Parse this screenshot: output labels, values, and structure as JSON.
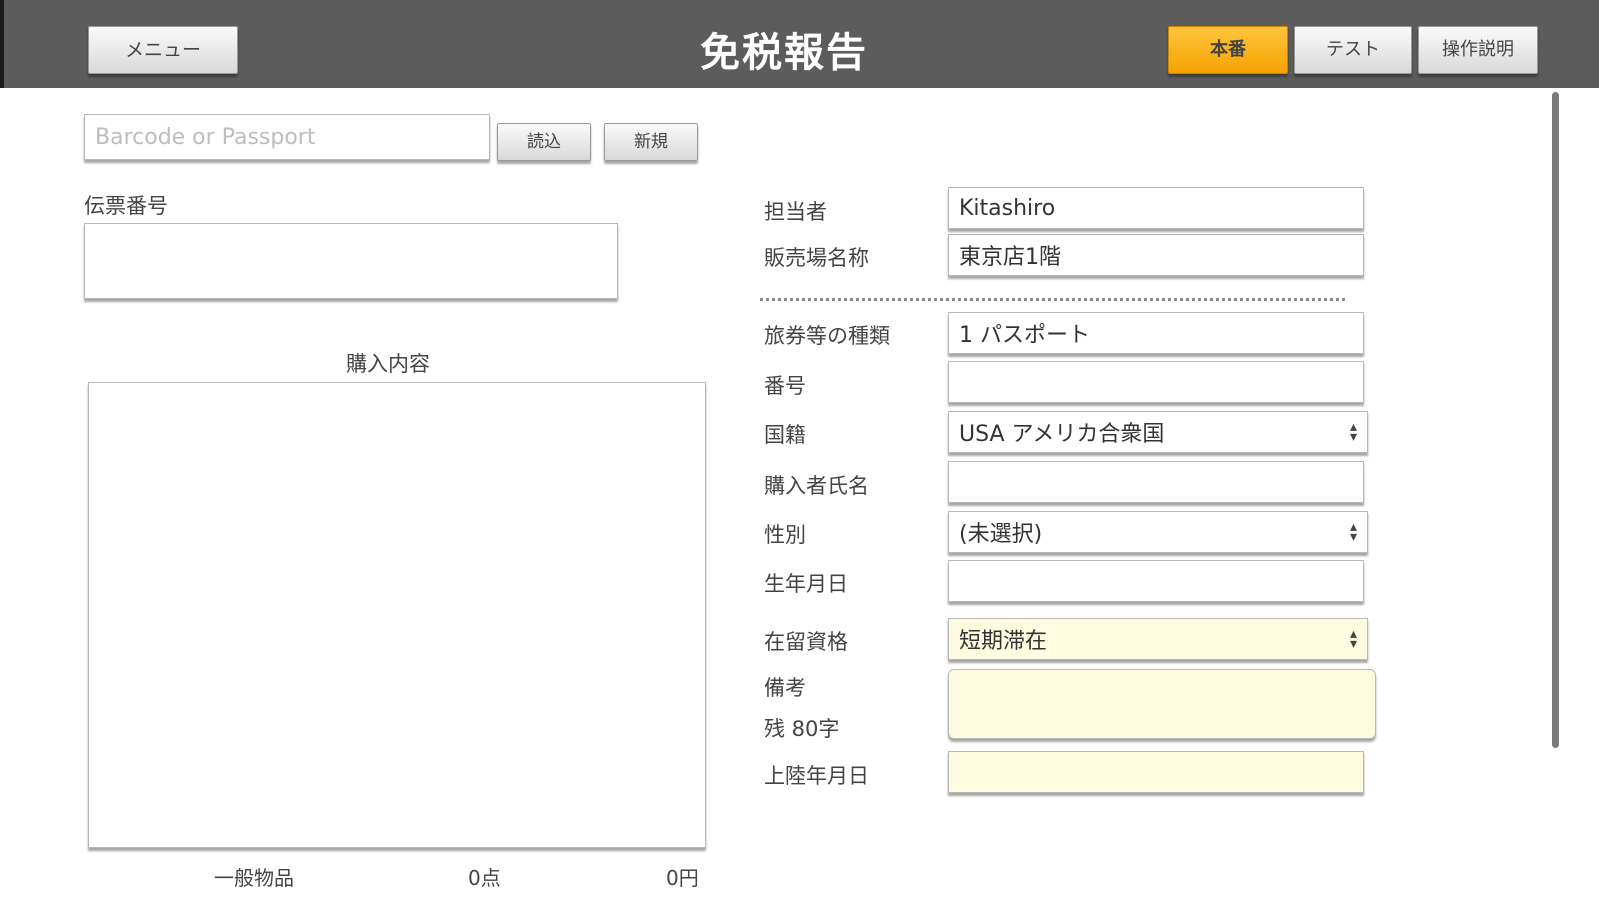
{
  "header": {
    "title": "免税報告",
    "menu_label": "メニュー",
    "mode_buttons": [
      {
        "label": "本番",
        "active": true
      },
      {
        "label": "テスト",
        "active": false
      },
      {
        "label": "操作説明",
        "active": false
      }
    ]
  },
  "colors": {
    "header_bg": "#5c5c5c",
    "active_button": "#f5a300",
    "highlight_field": "#fffbe0"
  },
  "search": {
    "placeholder": "Barcode or Passport",
    "value": "",
    "read_label": "読込",
    "new_label": "新規"
  },
  "slip": {
    "label": "伝票番号",
    "value": ""
  },
  "purchase": {
    "title": "購入内容",
    "summary": {
      "category": "一般物品",
      "count": "0点",
      "amount": "0円"
    }
  },
  "form": {
    "staff": {
      "label": "担当者",
      "value": "Kitashiro"
    },
    "store": {
      "label": "販売場名称",
      "value": "東京店1階"
    },
    "passport_type": {
      "label": "旅券等の種類",
      "value": "1 パスポート"
    },
    "number": {
      "label": "番号",
      "value": ""
    },
    "nationality": {
      "label": "国籍",
      "value": "USA アメリカ合衆国"
    },
    "buyer_name": {
      "label": "購入者氏名",
      "value": ""
    },
    "gender": {
      "label": "性別",
      "value": "(未選択)"
    },
    "birthdate": {
      "label": "生年月日",
      "value": ""
    },
    "residence_status": {
      "label": "在留資格",
      "value": "短期滞在"
    },
    "remarks": {
      "label": "備考",
      "remaining": "残 80字",
      "value": ""
    },
    "landing_date": {
      "label": "上陸年月日",
      "value": ""
    }
  }
}
